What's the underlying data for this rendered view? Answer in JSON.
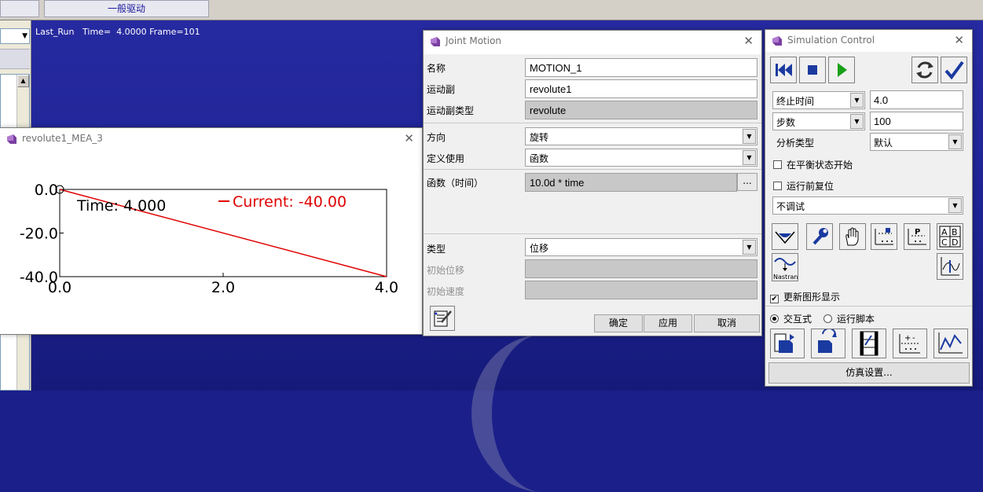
{
  "top": {
    "button_label": "一般驱动"
  },
  "status": {
    "run": "Last_Run",
    "time": "Time=  4.0000",
    "frame": "Frame=101"
  },
  "plot_window": {
    "title": "revolute1_MEA_3",
    "time_label": "Time:  4.000",
    "current_label": "Current:  -40.00",
    "line_color": "#e00000"
  },
  "chart_data": {
    "type": "line",
    "title": "",
    "xlabel": "",
    "ylabel": "",
    "x_ticks": [
      "0.0",
      "2.0",
      "4.0"
    ],
    "y_ticks": [
      "0.0",
      "-20.0",
      "-40.0"
    ],
    "xlim": [
      0,
      4
    ],
    "ylim": [
      -40,
      0
    ],
    "grid": false,
    "series": [
      {
        "x": [
          0,
          4
        ],
        "y": [
          0,
          -40
        ]
      }
    ]
  },
  "joint_motion": {
    "title": "Joint Motion",
    "name_label": "名称",
    "name_value": "MOTION_1",
    "joint_label": "运动副",
    "joint_value": "revolute1",
    "joint_type_label": "运动副类型",
    "joint_type_value": "revolute",
    "direction_label": "方向",
    "direction_value": "旋转",
    "define_label": "定义使用",
    "define_value": "函数",
    "function_label": "函数（时间）",
    "function_value": "10.0d * time",
    "dots_label": "...",
    "type_label": "类型",
    "type_value": "位移",
    "init_disp_label": "初始位移",
    "init_vel_label": "初始速度",
    "ok_label": "确定",
    "apply_label": "应用",
    "cancel_label": "取消"
  },
  "sim_control": {
    "title": "Simulation Control",
    "end_mode": "终止时间",
    "end_value": "4.0",
    "steps_mode": "步数",
    "steps_value": "100",
    "analysis_label": "分析类型",
    "analysis_value": "默认",
    "equilibrium_label": "在平衡状态开始",
    "reset_label": "运行前复位",
    "debug_value": "不调试",
    "nastran_label": "Nastran",
    "update_label": "更新图形显示",
    "interactive_label": "交互式",
    "script_label": "运行脚本",
    "settings_label": "仿真设置..."
  }
}
